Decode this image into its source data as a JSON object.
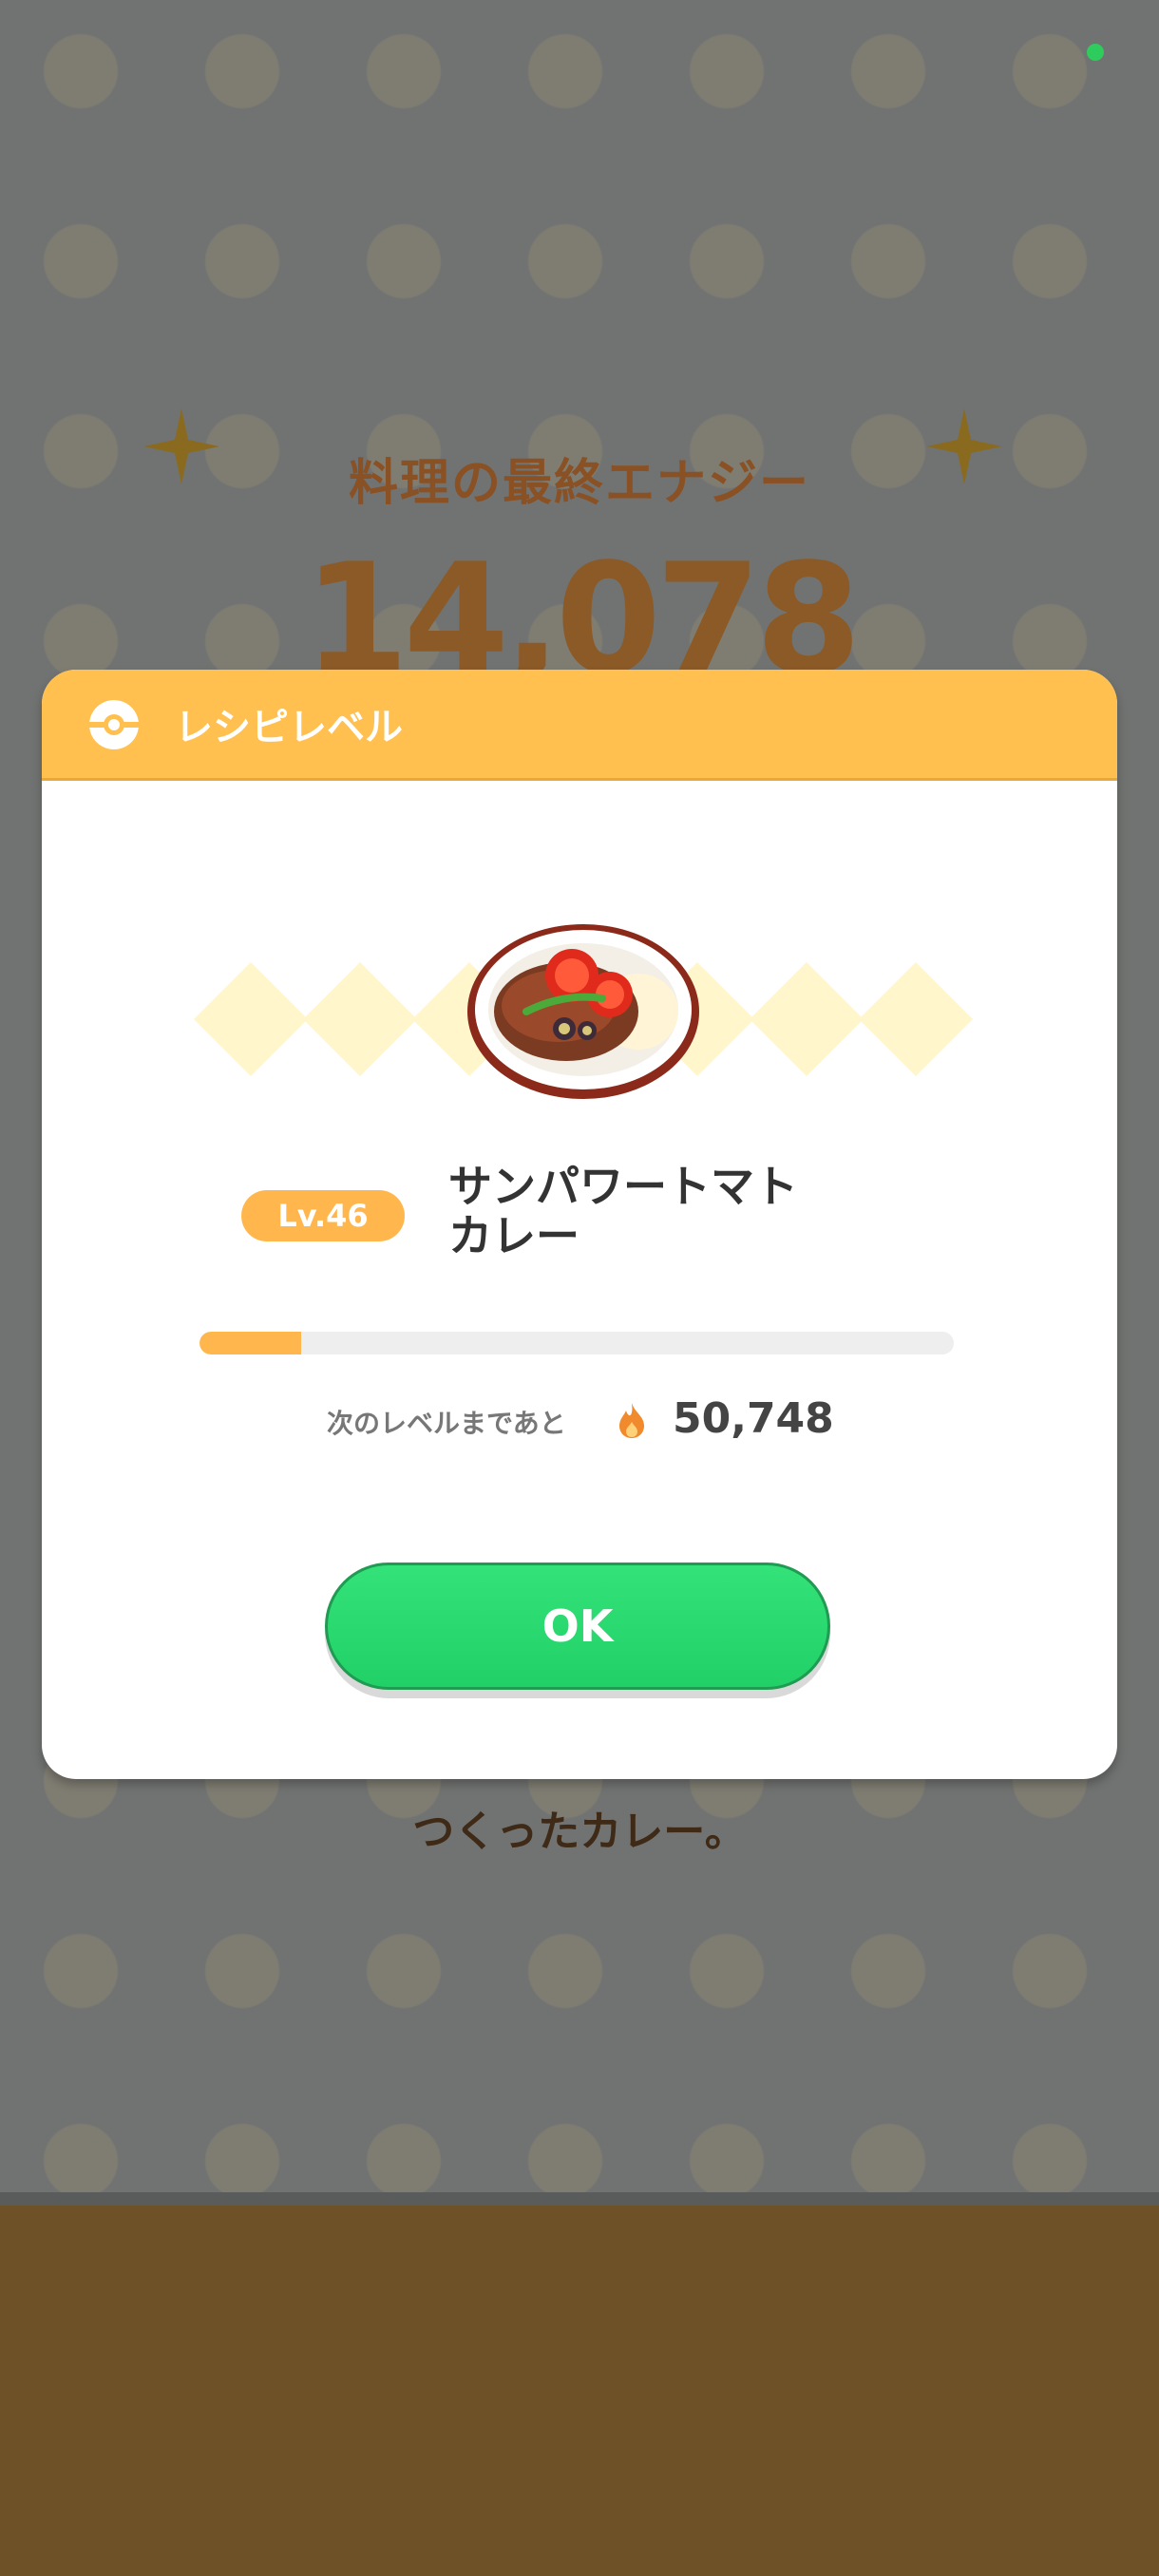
{
  "background": {
    "energy_title": "料理の最終エナジー",
    "energy_value": "14,078",
    "footer_text": "つくったカレー。"
  },
  "dialog": {
    "title": "レシピレベル",
    "recipe": {
      "level_badge": "Lv.46",
      "name_line1": "サンパワートマト",
      "name_line2": "カレー"
    },
    "progress": {
      "fraction": 0.135,
      "next_label": "次のレベルまであと",
      "next_value": "50,748"
    },
    "ok_label": "OK"
  },
  "colors": {
    "header": "#ffc04f",
    "badge": "#ffb74d",
    "ok_button": "#27d56d",
    "floor": "#6e5127"
  },
  "icons": [
    "pokeball-icon",
    "flame-icon",
    "sparkle-icon",
    "curry-dish-image"
  ]
}
